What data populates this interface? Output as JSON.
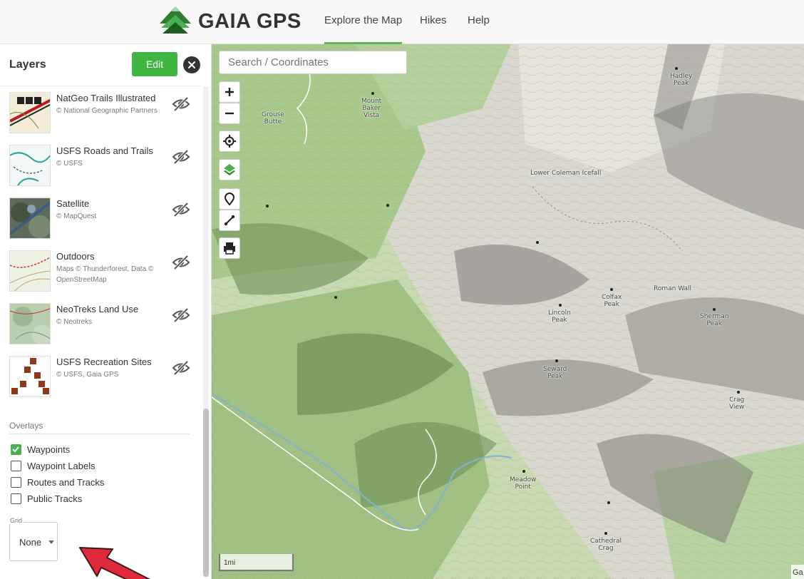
{
  "header": {
    "brand": "GAIA GPS",
    "logo_icon": "gaia-mountain-logo-icon",
    "nav": [
      {
        "label": "Explore the Map",
        "active": true
      },
      {
        "label": "Hikes",
        "active": false
      },
      {
        "label": "Help",
        "active": false
      }
    ],
    "accent": "#5cb85c"
  },
  "sidebar": {
    "title": "Layers",
    "edit_label": "Edit",
    "close_icon": "close-icon",
    "layers": [
      {
        "name": "NatGeo Trails Illustrated",
        "credit": "© National Geographic Partners",
        "thumb": "natgeo",
        "visibility_icon": "eye-slash-icon"
      },
      {
        "name": "USFS Roads and Trails",
        "credit": "© USFS",
        "thumb": "usfs-roads",
        "visibility_icon": "eye-slash-icon"
      },
      {
        "name": "Satellite",
        "credit": "© MapQuest",
        "thumb": "satellite",
        "visibility_icon": "eye-slash-icon"
      },
      {
        "name": "Outdoors",
        "credit": "Maps © Thunderforest, Data © OpenStreetMap",
        "thumb": "outdoors",
        "visibility_icon": "eye-slash-icon"
      },
      {
        "name": "NeoTreks Land Use",
        "credit": "© Neotreks",
        "thumb": "neotreks",
        "visibility_icon": "eye-slash-icon"
      },
      {
        "name": "USFS Recreation Sites",
        "credit": "© USFS, Gaia GPS",
        "thumb": "recreation",
        "visibility_icon": "eye-slash-icon"
      }
    ],
    "overlays_title": "Overlays",
    "overlays": [
      {
        "label": "Waypoints",
        "checked": true
      },
      {
        "label": "Waypoint Labels",
        "checked": false
      },
      {
        "label": "Routes and Tracks",
        "checked": false
      },
      {
        "label": "Public Tracks",
        "checked": false
      }
    ],
    "grid": {
      "legend": "Grid",
      "value": "None"
    },
    "edit_color": "#3fb541"
  },
  "map": {
    "search_placeholder": "Search / Coordinates",
    "controls": [
      "zoom-in-icon",
      "zoom-out-icon",
      "locate-icon",
      "layers-icon",
      "waypoint-icon",
      "route-icon",
      "print-icon"
    ],
    "labels": [
      {
        "text": "Hadley\nPeak"
      },
      {
        "text": "Mount\nBaker\nVista"
      },
      {
        "text": "Grouse\nButte"
      },
      {
        "text": "Lower Coleman Icefall"
      },
      {
        "text": "Colfax\nPeak"
      },
      {
        "text": "Roman Wall"
      },
      {
        "text": "Lincoln\nPeak"
      },
      {
        "text": "Sherman\nPeak"
      },
      {
        "text": "Seward\nPeak"
      },
      {
        "text": "Crag\nView"
      },
      {
        "text": "Meadow\nPoint"
      },
      {
        "text": "Cathedral\nCrag"
      }
    ],
    "scale_label": "1mi",
    "attribution": "Ga"
  }
}
